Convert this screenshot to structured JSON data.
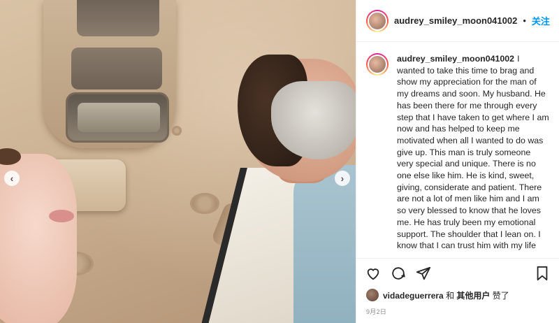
{
  "media": {
    "prev_label": "‹",
    "next_label": "›"
  },
  "header": {
    "username": "audrey_smiley_moon041002",
    "dot": "•",
    "follow_label": "关注",
    "more_label": "···"
  },
  "caption": {
    "username": "audrey_smiley_moon041002",
    "text": "I wanted to take this time to brag and show my appreciation for the man of my dreams and soon. My husband. He has been there for me through every step that I have taken to get where I am now and has helped to keep me motivated when all I wanted to do was give up. This man is truly someone very special and unique. There is no one else like him. He is kind, sweet, giving, considerate and patient. There are not a lot of men like him and I am so very blessed to know that he loves me. He has truly been my emotional support. The shoulder that I lean on. I know that I can trust him with my life and I hope he can trust me with his. Real compassionate love is out there"
  },
  "actions": {
    "like_icon": "heart-icon",
    "comment_icon": "comment-icon",
    "share_icon": "share-icon",
    "save_icon": "bookmark-icon"
  },
  "likes": {
    "liker": "vidadeguerrera",
    "connector": "和",
    "others": "其他用户",
    "suffix": "赞了"
  },
  "timestamp": "9月2日",
  "colors": {
    "link": "#0095f6",
    "text": "#262626",
    "muted": "#8e8e8e"
  }
}
